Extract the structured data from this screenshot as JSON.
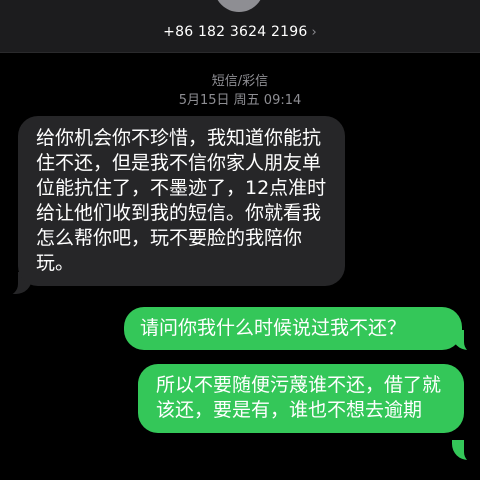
{
  "header": {
    "phone_number": "+86 182 3624 2196",
    "chevron": "›",
    "avatar_icon": "contact-avatar-icon"
  },
  "thread": {
    "service_label": "短信/彩信",
    "timestamp": "5月15日 周五 09:14"
  },
  "messages": [
    {
      "direction": "incoming",
      "text": "给你机会你不珍惜，我知道你能抗住不还，但是我不信你家人朋友单位能抗住了，不墨迹了，12点准时给让他们收到我的短信。你就看我怎么帮你吧，玩不要脸的我陪你玩。"
    },
    {
      "direction": "outgoing",
      "text": "请问你我什么时候说过我不还？"
    },
    {
      "direction": "outgoing",
      "text": "所以不要随便污蔑谁不还，借了就该还，要是有，谁也不想去逾期"
    }
  ],
  "colors": {
    "background": "#000000",
    "incoming_bubble": "#262628",
    "outgoing_bubble": "#34c759",
    "meta_text": "#8e8e93"
  }
}
